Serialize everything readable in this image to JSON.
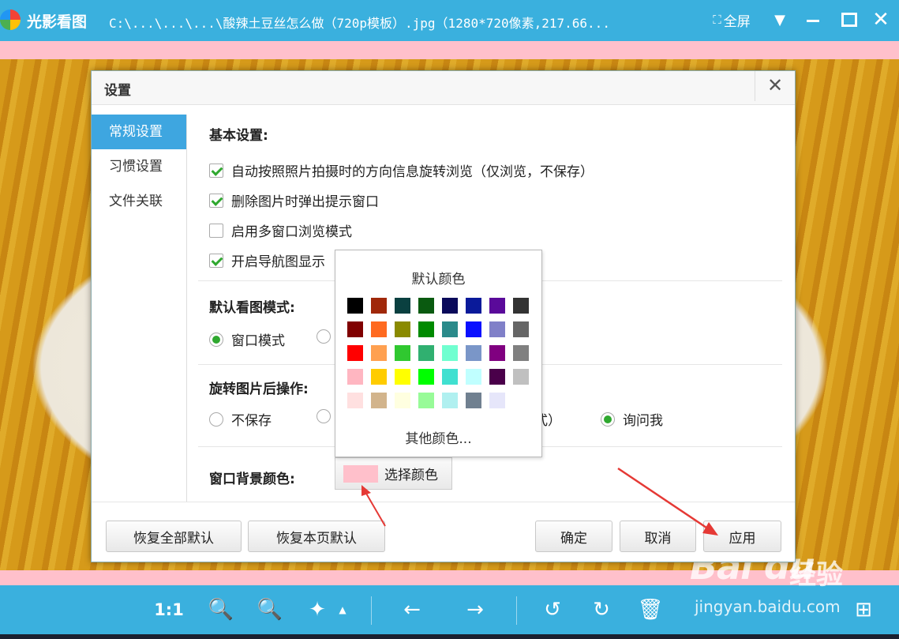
{
  "window": {
    "app_name": "光影看图",
    "file_path": "C:\\...\\...\\...\\酸辣土豆丝怎么做（720p模板）.jpg（1280*720像素,217.66...",
    "fullscreen_label": "全屏",
    "fullscreen_icon": "⛶",
    "menu_icon": "▼",
    "close_icon": "✕"
  },
  "colors": {
    "accent": "#3ab0de",
    "window_background": "#ffc0cb",
    "nav_active": "#3ea6e0",
    "check_green": "#2fa82f"
  },
  "dialog": {
    "title": "设置",
    "close_icon": "✕",
    "nav": [
      {
        "label": "常规设置",
        "active": true
      },
      {
        "label": "习惯设置",
        "active": false
      },
      {
        "label": "文件关联",
        "active": false
      }
    ],
    "basic": {
      "title": "基本设置:",
      "options": [
        {
          "label": "自动按照照片拍摄时的方向信息旋转浏览（仅浏览，不保存）",
          "checked": true
        },
        {
          "label": "删除图片时弹出提示窗口",
          "checked": true
        },
        {
          "label": "启用多窗口浏览模式",
          "checked": false
        },
        {
          "label": "开启导航图显示",
          "checked": true
        }
      ]
    },
    "view_mode": {
      "title": "默认看图模式:",
      "option_window": "窗口模式"
    },
    "rotate": {
      "title": "旋转图片后操作:",
      "option_nosave": "不保存",
      "option_partial": "式）",
      "option_ask": "询问我"
    },
    "bg_color": {
      "title": "窗口背景颜色:",
      "button_label": "选择颜色",
      "current": "#ffc0cb"
    },
    "buttons": {
      "restore_all": "恢复全部默认",
      "restore_page": "恢复本页默认",
      "ok": "确定",
      "cancel": "取消",
      "apply": "应用"
    }
  },
  "color_popup": {
    "title": "默认颜色",
    "more": "其他颜色...",
    "swatches": [
      "#000000",
      "#a0280a",
      "#0a4040",
      "#0a5a10",
      "#0a0a5a",
      "#0a1a9a",
      "#5a0a9a",
      "#333333",
      "#800000",
      "#ff6a20",
      "#8a8a00",
      "#008a00",
      "#2a8a8a",
      "#0a10ff",
      "#8080c8",
      "#666666",
      "#ff0000",
      "#ffa050",
      "#30c830",
      "#30b070",
      "#70ffd0",
      "#7a96c8",
      "#800080",
      "#808080",
      "#ffb6c1",
      "#ffcc00",
      "#ffff00",
      "#00ff00",
      "#40e0d0",
      "#c0ffff",
      "#4a004a",
      "#c0c0c0",
      "#ffe0e0",
      "#d2b48c",
      "#ffffe0",
      "#98fb98",
      "#b0f0f0",
      "#708090",
      "#e6e6fa",
      ""
    ]
  },
  "toolbar": {
    "ratio_label": "1:1",
    "zoom_in_icon": "🔍",
    "zoom_out_icon": "🔍",
    "magic_icon": "✦",
    "caret_icon": "▲",
    "prev_icon": "←",
    "next_icon": "→",
    "rotate_left_icon": "↺",
    "rotate_right_icon": "↻",
    "delete_icon": "🗑",
    "grid_icon": "⊞"
  },
  "watermark": {
    "logo": "Bai du",
    "sub": "经验",
    "url": "jingyan.baidu.com"
  }
}
